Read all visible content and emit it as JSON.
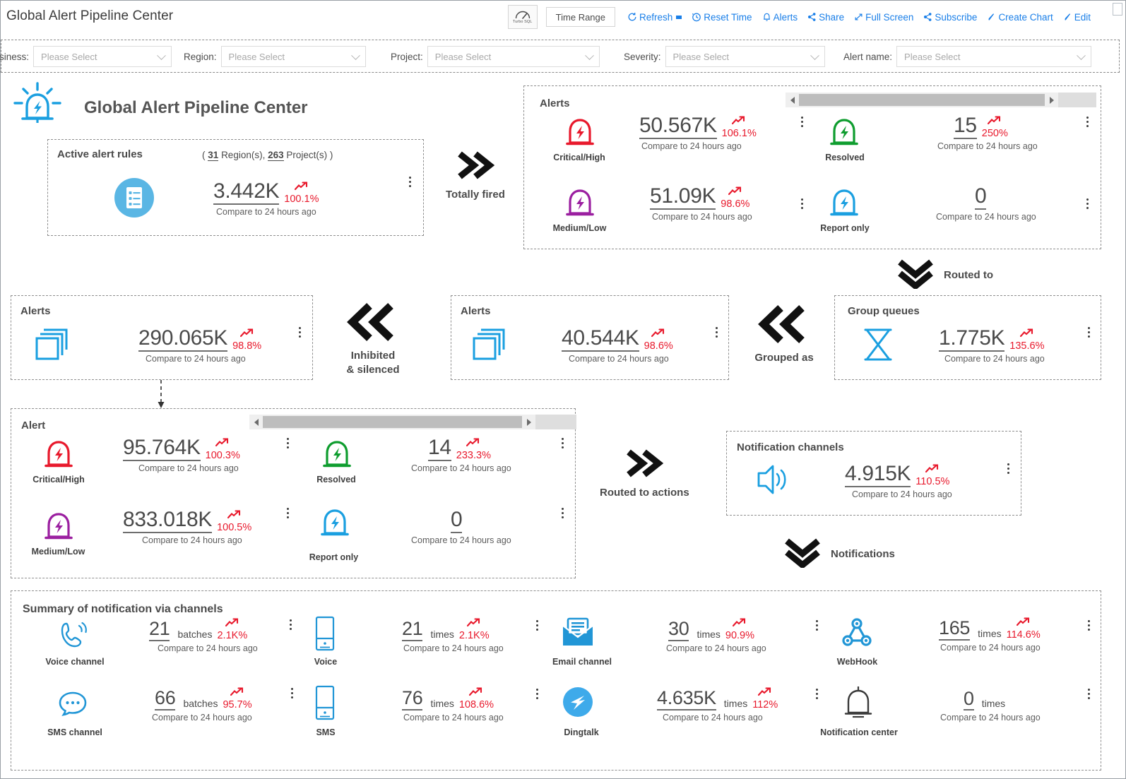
{
  "window": {
    "title": "Global Alert Pipeline Center"
  },
  "toolbar": {
    "turbo_sql_label": "Turbo SQL",
    "time_range_label": "Time Range",
    "items": [
      {
        "label": "Refresh",
        "icon": "refresh-icon",
        "has_caret": true
      },
      {
        "label": "Reset Time",
        "icon": "reset-time-icon",
        "has_caret": false
      },
      {
        "label": "Alerts",
        "icon": "bell-icon",
        "has_caret": false
      },
      {
        "label": "Share",
        "icon": "share-icon",
        "has_caret": false
      },
      {
        "label": "Full Screen",
        "icon": "full-screen-icon",
        "has_caret": false
      },
      {
        "label": "Subscribe",
        "icon": "share-icon",
        "has_caret": false
      },
      {
        "label": "Create Chart",
        "icon": "pencil-icon",
        "has_caret": false
      },
      {
        "label": "Edit",
        "icon": "pencil-icon",
        "has_caret": false
      }
    ]
  },
  "filters": [
    {
      "label": "siness:",
      "placeholder": "Please Select"
    },
    {
      "label": "Region:",
      "placeholder": "Please Select"
    },
    {
      "label": "Project:",
      "placeholder": "Please Select"
    },
    {
      "label": "Severity:",
      "placeholder": "Please Select"
    },
    {
      "label": "Alert name:",
      "placeholder": "Please Select"
    }
  ],
  "dashboard": {
    "heading": "Global Alert Pipeline Center",
    "heading_icon": "alarm-light-icon",
    "compare_text": "Compare to 24 hours ago",
    "active_rules": {
      "title": "Active alert rules",
      "scope_prefix": "(",
      "regions": "31",
      "regions_unit": "Region(s),",
      "projects": "263",
      "projects_unit": "Project(s) )",
      "icon": "rules-list-icon",
      "value": "3.442K",
      "pct": "100.1%",
      "compare": "Compare to 24 hours ago"
    },
    "flow_totally_fired": {
      "label": "Totally fired",
      "icon": "double-chevron-right-icon"
    },
    "alerts_fired": {
      "title": "Alerts",
      "cells": [
        {
          "sev": "Critical/High",
          "icon": "alarm-icon",
          "color": "#e8192c",
          "value": "50.567K",
          "pct": "106.1%",
          "compare": "Compare to 24 hours ago"
        },
        {
          "sev": "Medium/Low",
          "icon": "alarm-icon",
          "color": "#9b1fa0",
          "value": "51.09K",
          "pct": "98.6%",
          "compare": "Compare to 24 hours ago"
        },
        {
          "sev": "Resolved",
          "icon": "alarm-icon",
          "color": "#0f9d2f",
          "value": "15",
          "pct": "250%",
          "compare": "Compare to 24 hours ago"
        },
        {
          "sev": "Report only",
          "icon": "alarm-icon",
          "color": "#1a9fe0",
          "value": "0",
          "pct": "",
          "compare": "Compare to 24 hours ago"
        }
      ]
    },
    "flow_routed_to": {
      "label": "Routed to",
      "icon": "double-chevron-down-icon"
    },
    "inhibited": {
      "title": "Alerts",
      "icon": "stacked-layers-icon",
      "value": "290.065K",
      "pct": "98.8%",
      "compare": "Compare to 24 hours ago"
    },
    "flow_inhibited": {
      "label_line1": "Inhibited",
      "label_line2": "& silenced",
      "icon": "double-chevron-left-icon"
    },
    "grouped_alerts": {
      "title": "Alerts",
      "icon": "stacked-layers-icon",
      "value": "40.544K",
      "pct": "98.6%",
      "compare": "Compare to 24 hours ago"
    },
    "flow_grouped": {
      "label": "Grouped as",
      "icon": "double-chevron-left-icon"
    },
    "group_queues": {
      "title": "Group queues",
      "icon": "hourglass-icon",
      "value": "1.775K",
      "pct": "135.6%",
      "compare": "Compare to 24 hours ago"
    },
    "alert_detail": {
      "title": "Alert",
      "cells": [
        {
          "sev": "Critical/High",
          "icon": "alarm-icon",
          "color": "#e8192c",
          "value": "95.764K",
          "pct": "100.3%",
          "compare": "Compare to 24 hours ago"
        },
        {
          "sev": "Medium/Low",
          "icon": "alarm-icon",
          "color": "#9b1fa0",
          "value": "833.018K",
          "pct": "100.5%",
          "compare": "Compare to 24 hours ago"
        },
        {
          "sev": "Resolved",
          "icon": "alarm-icon",
          "color": "#0f9d2f",
          "value": "14",
          "pct": "233.3%",
          "compare": "Compare to 24 hours ago"
        },
        {
          "sev": "Report only",
          "icon": "alarm-icon",
          "color": "#1a9fe0",
          "value": "0",
          "pct": "",
          "compare": "Compare to 24 hours ago"
        }
      ]
    },
    "flow_routed_actions": {
      "label": "Routed to actions",
      "icon": "double-chevron-right-icon"
    },
    "notification_channels": {
      "title": "Notification channels",
      "icon": "speaker-icon",
      "value": "4.915K",
      "pct": "110.5%",
      "compare": "Compare to 24 hours ago"
    },
    "flow_notifications": {
      "label": "Notifications",
      "icon": "double-chevron-down-icon"
    },
    "summary": {
      "title": "Summary of notification via channels",
      "cells": [
        {
          "name": "Voice channel",
          "icon": "voice-call-icon",
          "value": "21",
          "unit": "batches",
          "pct": "2.1K%",
          "compare": "Compare to 24 hours ago"
        },
        {
          "name": "SMS channel",
          "icon": "sms-bubble-icon",
          "value": "66",
          "unit": "batches",
          "pct": "95.7%",
          "compare": "Compare to 24 hours ago"
        },
        {
          "name": "Voice",
          "icon": "phone-icon",
          "value": "21",
          "unit": "times",
          "pct": "2.1K%",
          "compare": "Compare to 24 hours ago"
        },
        {
          "name": "SMS",
          "icon": "phone-icon",
          "value": "76",
          "unit": "times",
          "pct": "108.6%",
          "compare": "Compare to 24 hours ago"
        },
        {
          "name": "Email channel",
          "icon": "email-icon",
          "value": "30",
          "unit": "times",
          "pct": "90.9%",
          "compare": "Compare to 24 hours ago"
        },
        {
          "name": "Dingtalk",
          "icon": "dingtalk-icon",
          "value": "4.635K",
          "unit": "times",
          "pct": "112%",
          "compare": "Compare to 24 hours ago"
        },
        {
          "name": "WebHook",
          "icon": "webhook-icon",
          "value": "165",
          "unit": "times",
          "pct": "114.6%",
          "compare": "Compare to 24 hours ago"
        },
        {
          "name": "Notification center",
          "icon": "bell-outline-icon",
          "value": "0",
          "unit": "times",
          "pct": "",
          "compare": "Compare to 24 hours ago"
        }
      ]
    },
    "scrollbars": {
      "alerts_panel": "horizontal-scrollbar",
      "alert_panel": "horizontal-scrollbar"
    }
  },
  "colors": {
    "accent": "#1a7fe8",
    "critical": "#e8192c",
    "medium": "#9b1fa0",
    "resolved": "#0f9d2f",
    "report": "#1a9fe0",
    "trend_up": "#e8192c"
  }
}
